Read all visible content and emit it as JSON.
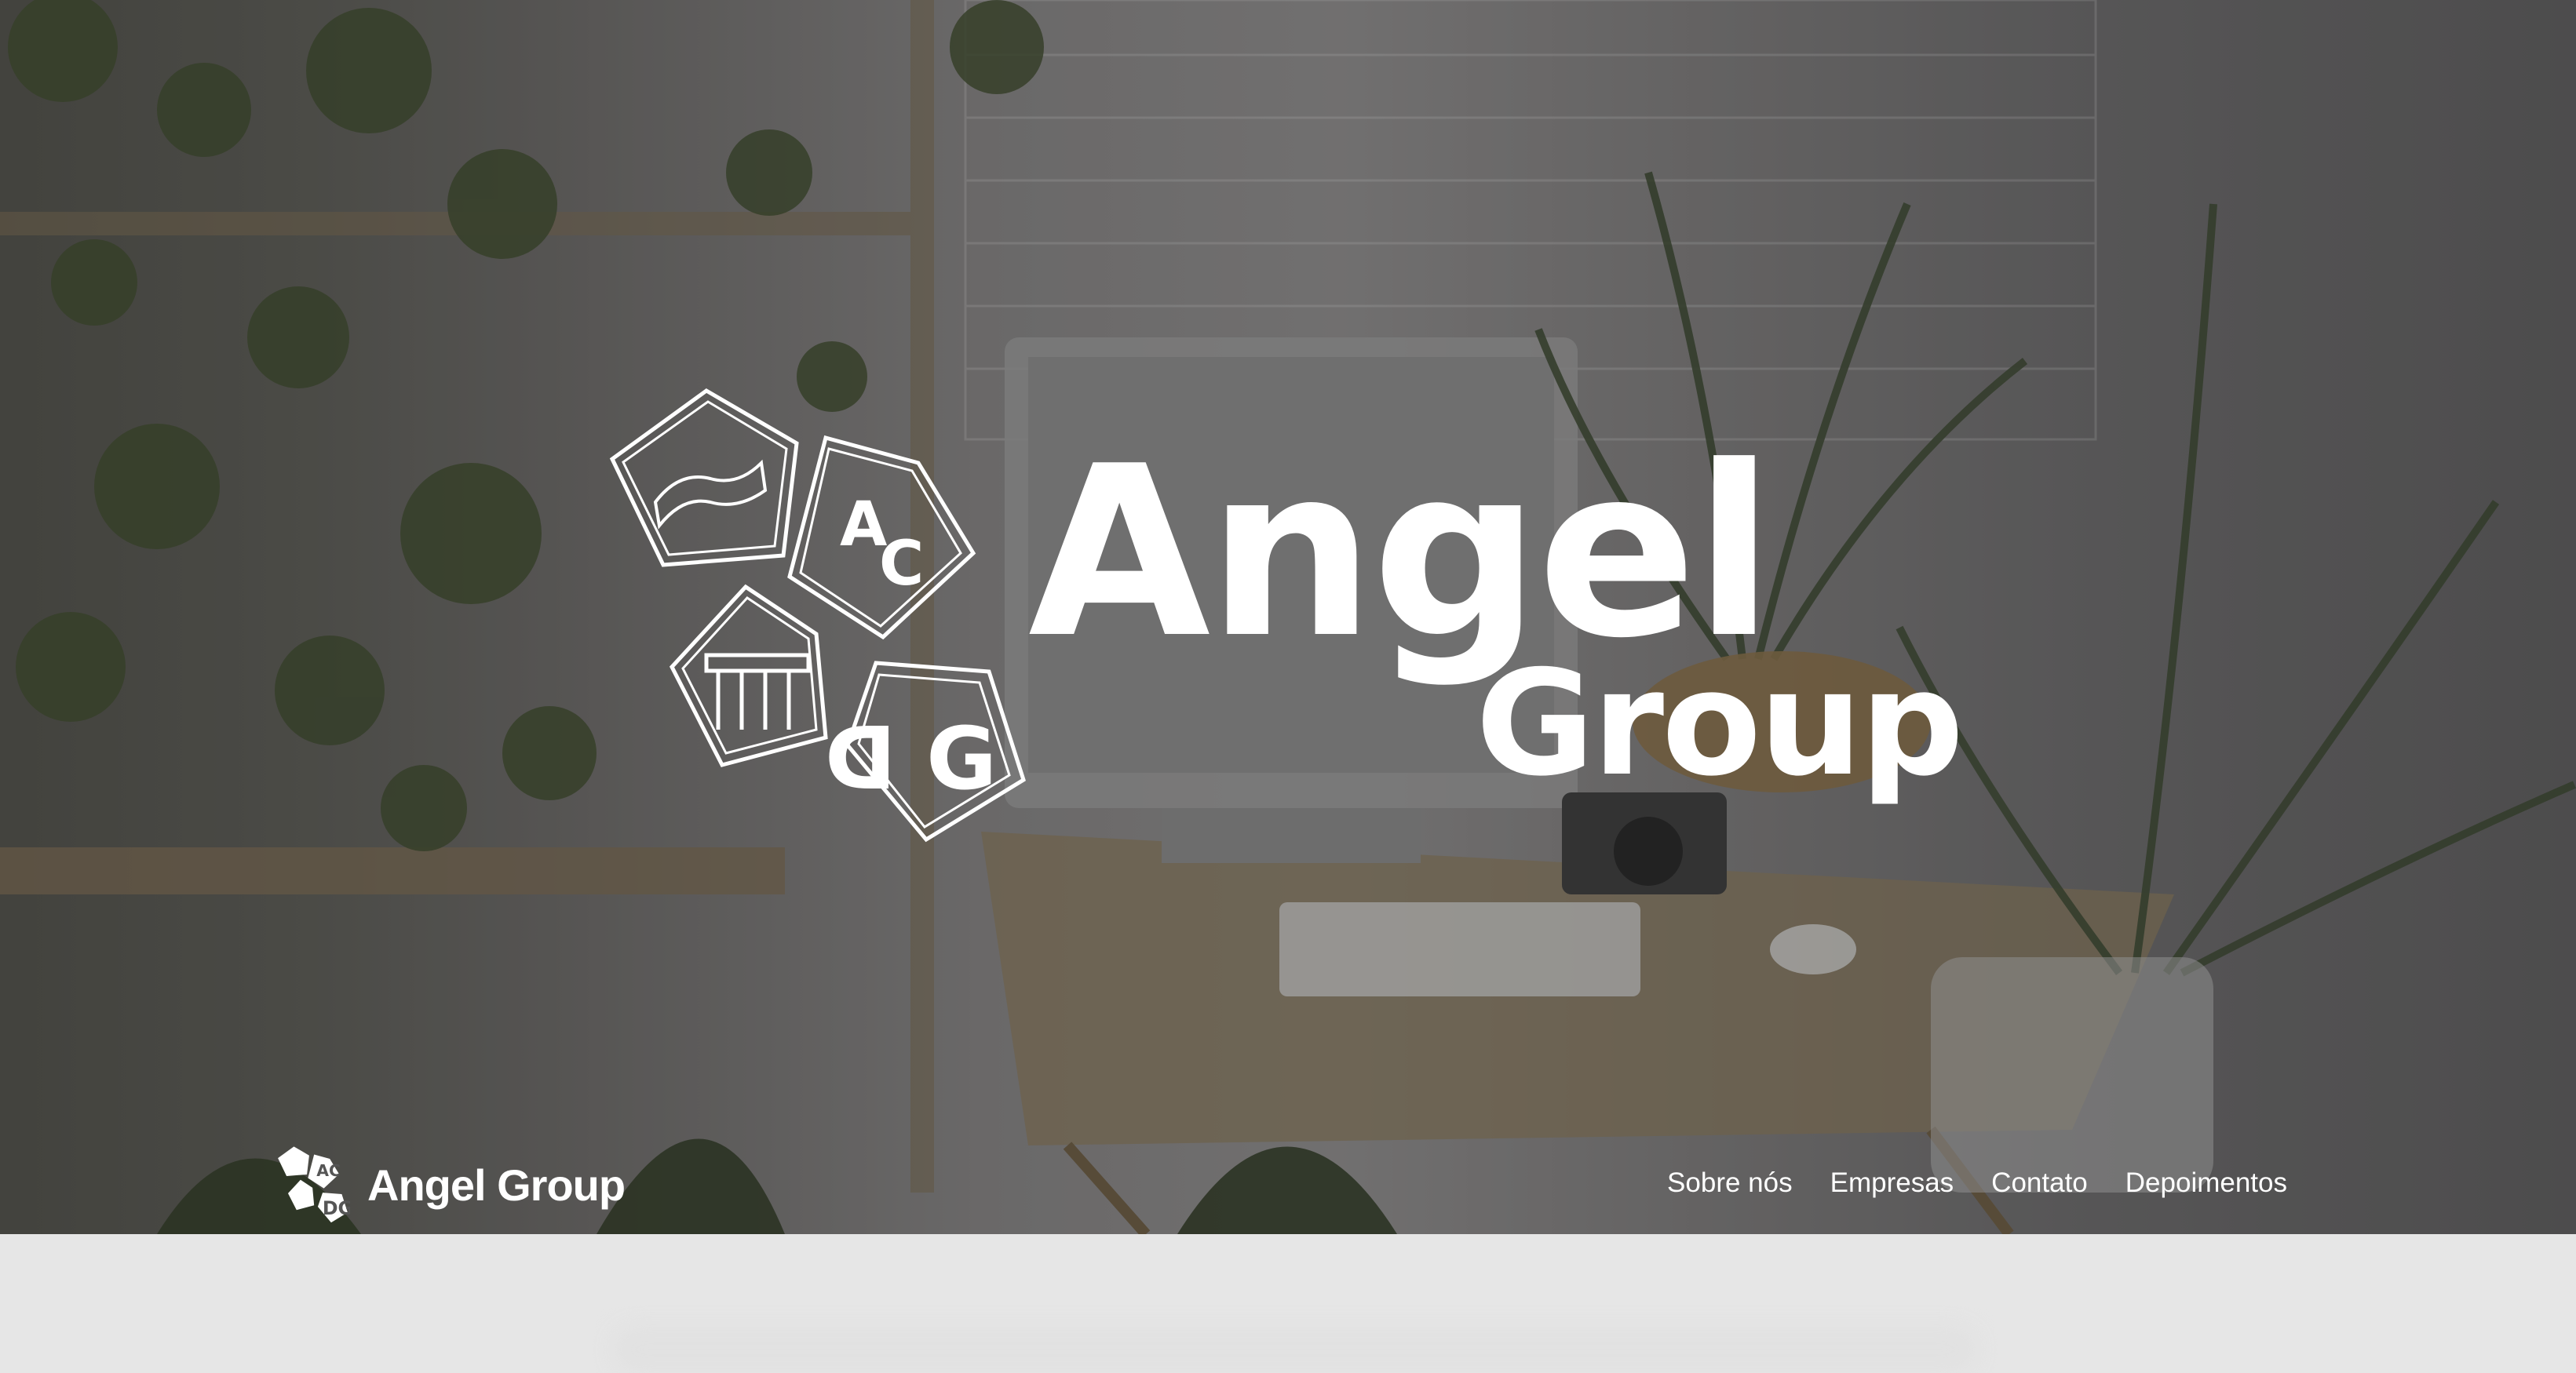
{
  "hero": {
    "title": "Angel",
    "subtitle": "Group",
    "logo_cells": [
      "wave-emblem",
      "AC",
      "building-emblem",
      "DG"
    ]
  },
  "navbar": {
    "brand_name": "Angel Group",
    "links": [
      "Sobre nós",
      "Empresas",
      "Contato",
      "Depoimentos"
    ]
  },
  "colors": {
    "hero_overlay": "#3c3c3c",
    "text": "#ffffff",
    "page_bg": "#e6e6e6"
  }
}
